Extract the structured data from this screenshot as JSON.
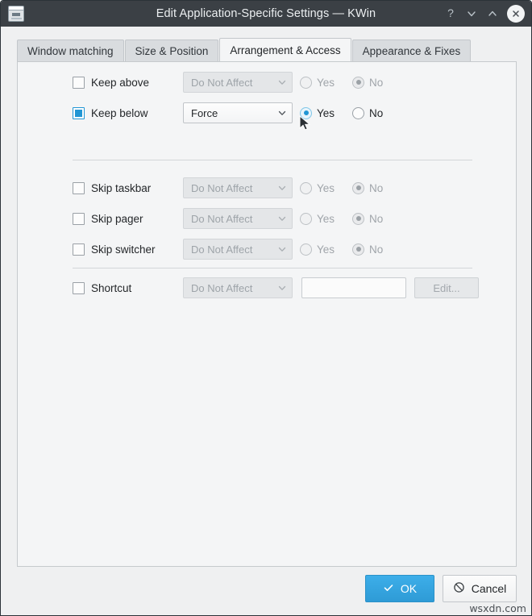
{
  "window": {
    "title": "Edit Application-Specific Settings — KWin",
    "app_icon": "window-settings-icon",
    "controls": {
      "help": "?",
      "minimize": "chevron-down",
      "maximize": "chevron-up",
      "close": "x"
    }
  },
  "tabs": [
    {
      "label": "Window matching",
      "selected": false
    },
    {
      "label": "Size & Position",
      "selected": false
    },
    {
      "label": "Arrangement & Access",
      "selected": true
    },
    {
      "label": "Appearance & Fixes",
      "selected": false
    }
  ],
  "rows": [
    {
      "name": "keep-above",
      "label": "Keep above",
      "checked": false,
      "enabled": false,
      "combo_value": "Do Not Affect",
      "yes_label": "Yes",
      "no_label": "No",
      "selected": "No"
    },
    {
      "name": "keep-below",
      "label": "Keep below",
      "checked": true,
      "enabled": true,
      "combo_value": "Force",
      "yes_label": "Yes",
      "no_label": "No",
      "selected": "Yes"
    },
    {
      "name": "skip-taskbar",
      "label": "Skip taskbar",
      "checked": false,
      "enabled": false,
      "combo_value": "Do Not Affect",
      "yes_label": "Yes",
      "no_label": "No",
      "selected": "No"
    },
    {
      "name": "skip-pager",
      "label": "Skip pager",
      "checked": false,
      "enabled": false,
      "combo_value": "Do Not Affect",
      "yes_label": "Yes",
      "no_label": "No",
      "selected": "No"
    },
    {
      "name": "skip-switcher",
      "label": "Skip switcher",
      "checked": false,
      "enabled": false,
      "combo_value": "Do Not Affect",
      "yes_label": "Yes",
      "no_label": "No",
      "selected": "No"
    }
  ],
  "shortcut": {
    "label": "Shortcut",
    "checked": false,
    "combo_value": "Do Not Affect",
    "field_value": "",
    "edit_label": "Edit..."
  },
  "footer": {
    "ok_label": "OK",
    "cancel_label": "Cancel"
  },
  "watermark": "wsxdn.com",
  "colors": {
    "titlebar": "#3b4045",
    "accent": "#3daee9",
    "checkbox_checked": "#2196d4",
    "dialog_bg": "#eff0f1",
    "panel_bg": "#f4f5f6"
  }
}
